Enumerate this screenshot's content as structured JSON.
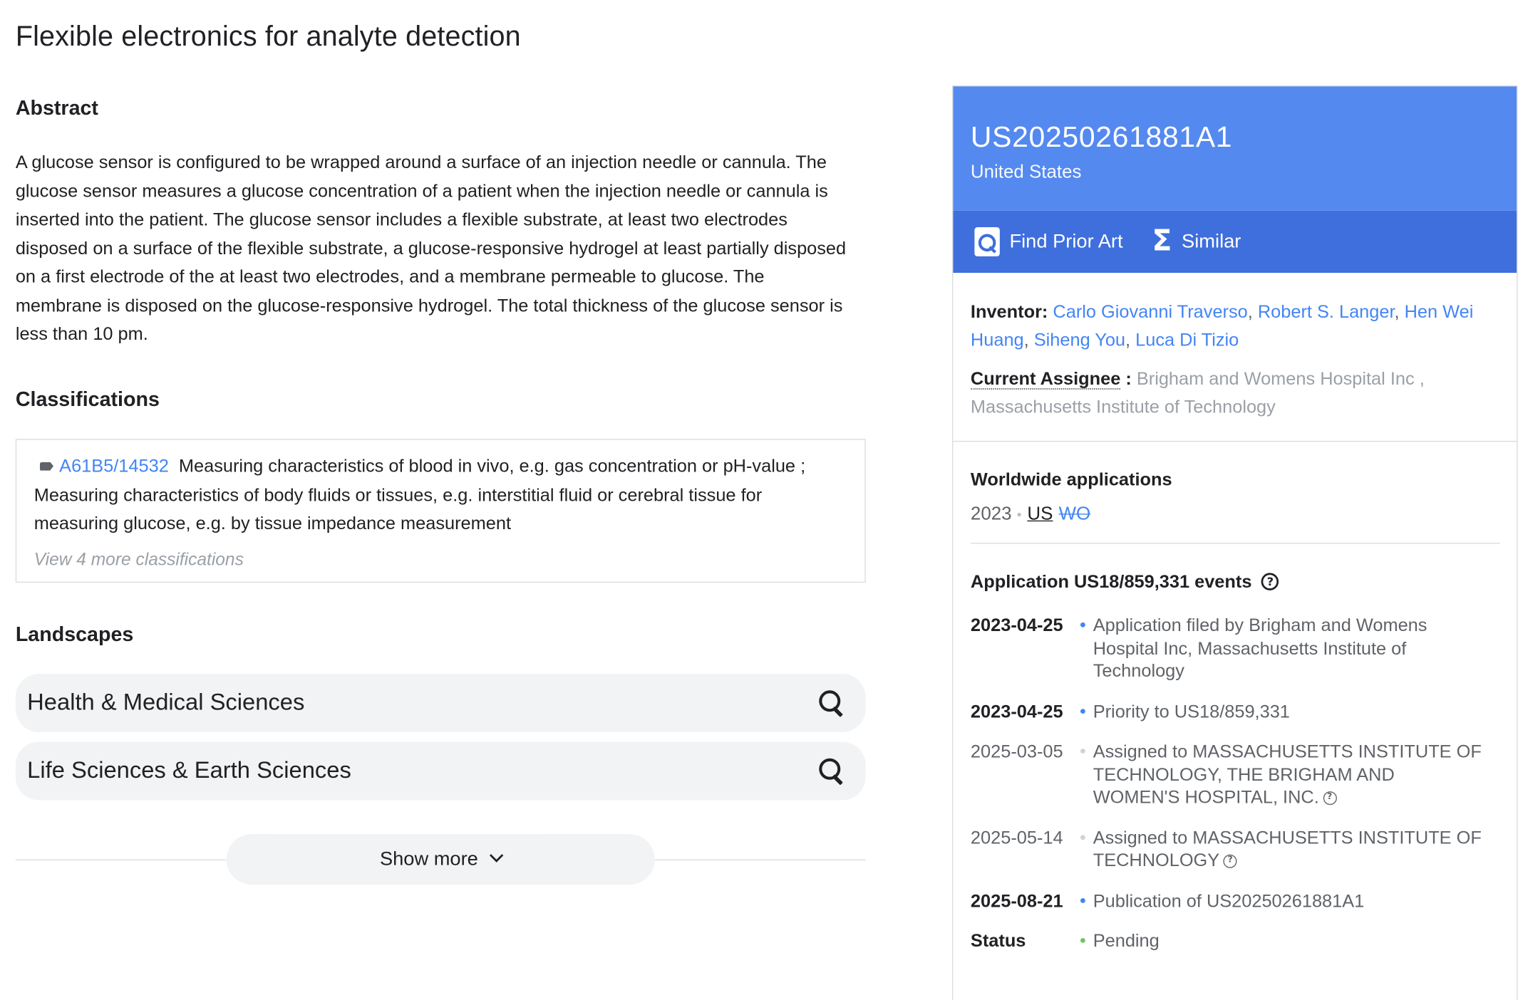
{
  "title": "Flexible electronics for analyte detection",
  "abstract": {
    "heading": "Abstract",
    "text": "A glucose sensor is configured to be wrapped around a surface of an injection needle or cannula. The glucose sensor measures a glucose concentration of a patient when the injection needle or cannula is inserted into the patient. The glucose sensor includes a flexible substrate, at least two electrodes disposed on a surface of the flexible substrate, a glucose-responsive hydrogel at least partially disposed on a first electrode of the at least two electrodes, and a membrane permeable to glucose. The membrane is disposed on the glucose-responsive hydrogel. The total thickness of the glucose sensor is less than 10 pm."
  },
  "classifications": {
    "heading": "Classifications",
    "code": "A61B5/14532",
    "description": "Measuring characteristics of blood in vivo, e.g. gas concentration or pH-value ; Measuring characteristics of body fluids or tissues, e.g. interstitial fluid or cerebral tissue for measuring glucose, e.g. by tissue impedance measurement",
    "view_more": "View 4 more classifications"
  },
  "landscapes": {
    "heading": "Landscapes",
    "items": [
      {
        "label": "Health & Medical Sciences"
      },
      {
        "label": "Life Sciences & Earth Sciences"
      }
    ]
  },
  "show_more": "Show more",
  "panel": {
    "pub_number": "US20250261881A1",
    "country": "United States",
    "actions": {
      "prior_art": "Find Prior Art",
      "similar": "Similar"
    },
    "inventor_label": "Inventor:",
    "inventors": [
      "Carlo Giovanni Traverso",
      "Robert S. Langer",
      "Hen Wei Huang",
      "Siheng You",
      "Luca Di Tizio"
    ],
    "assignee_label": "Current Assignee",
    "assignee_colon": " :",
    "assignee": "Brigham and Womens Hospital Inc , Massachusetts Institute of Technology",
    "worldwide": {
      "heading": "Worldwide applications",
      "year": "2023",
      "codes": [
        "US",
        "WO"
      ]
    },
    "events": {
      "heading": "Application US18/859,331 events",
      "list": [
        {
          "date": "2023-04-25",
          "text": "Application filed by Brigham and Womens Hospital Inc, Massachusetts Institute of Technology",
          "key": true,
          "help": false
        },
        {
          "date": "2023-04-25",
          "text": "Priority to US18/859,331",
          "key": true,
          "help": false
        },
        {
          "date": "2025-03-05",
          "text": "Assigned to MASSACHUSETTS INSTITUTE OF TECHNOLOGY, THE BRIGHAM AND WOMEN'S HOSPITAL, INC.",
          "key": false,
          "help": true
        },
        {
          "date": "2025-05-14",
          "text": "Assigned to MASSACHUSETTS INSTITUTE OF TECHNOLOGY",
          "key": false,
          "help": true
        },
        {
          "date": "2025-08-21",
          "text": "Publication of US20250261881A1",
          "key": true,
          "help": false
        }
      ],
      "status_label": "Status",
      "status_value": "Pending"
    },
    "colors": {
      "header": "#5489f0",
      "actions": "#3f6fdd",
      "link": "#4285f4",
      "status_dot": "#6ac46a",
      "minor_dot": "#cfd2d6"
    }
  }
}
